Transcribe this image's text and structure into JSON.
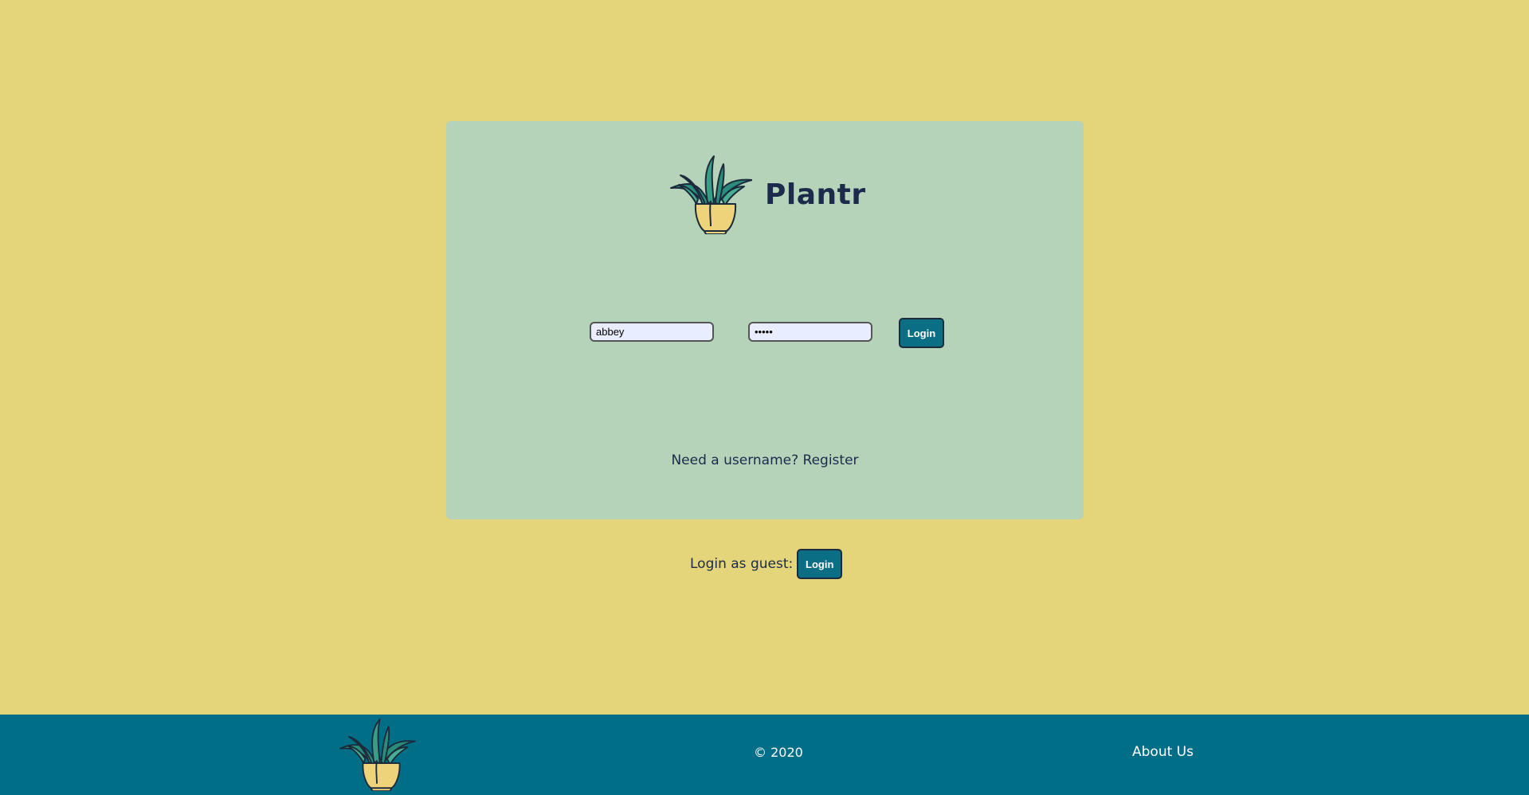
{
  "colors": {
    "background": "#e4d47a",
    "card": "#b5d3b9",
    "button": "#0a6f85",
    "footer": "#006e86",
    "text": "#1c2b4b"
  },
  "header": {
    "logo_icon": "potted-plant-icon",
    "brand": "Plantr"
  },
  "login_form": {
    "username_value": "abbey",
    "password_value": "abbey",
    "login_label": "Login"
  },
  "register": {
    "prompt": "Need a username?",
    "link_label": "Register"
  },
  "guest": {
    "label": "Login as guest:",
    "login_label": "Login"
  },
  "footer": {
    "logo_icon": "potted-plant-icon",
    "copyright": "© 2020",
    "about_label": "About Us"
  }
}
